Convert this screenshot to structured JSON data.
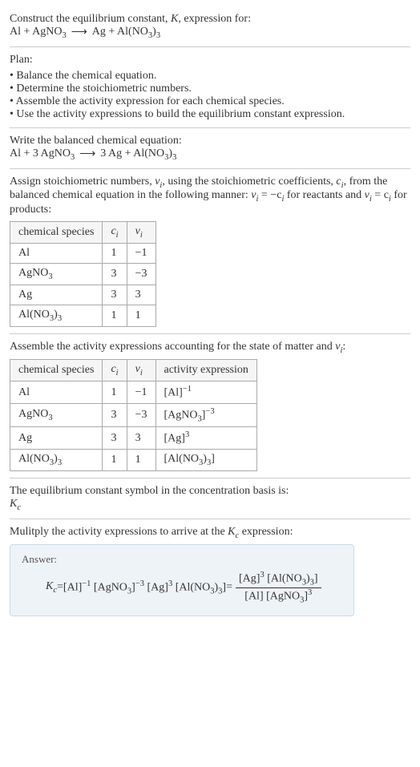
{
  "intro": {
    "line1_a": "Construct the equilibrium constant, ",
    "line1_K": "K",
    "line1_b": ", expression for:",
    "reaction_lhs": "Al + AgNO",
    "reaction_arrow": "⟶",
    "reaction_rhs_a": "Ag + Al(NO",
    "reaction_rhs_b": ")"
  },
  "plan": {
    "heading": "Plan:",
    "items": [
      "Balance the chemical equation.",
      "Determine the stoichiometric numbers.",
      "Assemble the activity expression for each chemical species.",
      "Use the activity expressions to build the equilibrium constant expression."
    ]
  },
  "balanced": {
    "heading": "Write the balanced chemical equation:",
    "lhs_a": "Al + 3 AgNO",
    "arrow": "⟶",
    "rhs_a": "3 Ag + Al(NO",
    "rhs_b": ")"
  },
  "stoich": {
    "text_a": "Assign stoichiometric numbers, ",
    "nu": "ν",
    "sub_i": "i",
    "text_b": ", using the stoichiometric coefficients, ",
    "c": "c",
    "text_c": ", from the balanced chemical equation in the following manner: ",
    "eq1_a": "ν",
    "eq1_b": " = −c",
    "text_d": " for reactants and ",
    "eq2_a": "ν",
    "eq2_b": " = c",
    "text_e": " for products:",
    "headers": {
      "species": "chemical species",
      "ci": "c",
      "nui": "ν"
    },
    "rows": [
      {
        "species": "Al",
        "ci": "1",
        "nui": "−1"
      },
      {
        "species": "AgNO",
        "ci": "3",
        "nui": "−3"
      },
      {
        "species": "Ag",
        "ci": "3",
        "nui": "3"
      },
      {
        "species": "Al(NO",
        "ci": "1",
        "nui": "1"
      }
    ]
  },
  "activity": {
    "heading_a": "Assemble the activity expressions accounting for the state of matter and ",
    "heading_b": ":",
    "headers": {
      "species": "chemical species",
      "ci": "c",
      "nui": "ν",
      "act": "activity expression"
    },
    "rows": [
      {
        "species": "Al",
        "ci": "1",
        "nui": "−1",
        "act_base": "[Al]",
        "act_exp": "−1"
      },
      {
        "species": "AgNO",
        "ci": "3",
        "nui": "−3",
        "act_base": "[AgNO",
        "act_exp": "−3"
      },
      {
        "species": "Ag",
        "ci": "3",
        "nui": "3",
        "act_base": "[Ag]",
        "act_exp": "3"
      },
      {
        "species": "Al(NO",
        "ci": "1",
        "nui": "1",
        "act_base": "[Al(NO",
        "act_exp": ""
      }
    ]
  },
  "symbol": {
    "line": "The equilibrium constant symbol in the concentration basis is:",
    "Kc_K": "K",
    "Kc_c": "c"
  },
  "multiply": {
    "line_a": "Mulitply the activity expressions to arrive at the ",
    "line_b": " expression:"
  },
  "answer": {
    "label": "Answer:",
    "lhs_K": "K",
    "lhs_c": "c",
    "eq": " = ",
    "t1": "[Al]",
    "e1": "−1",
    "t2": " [AgNO",
    "e2": "−3",
    "t3": " [Ag]",
    "e3": "3",
    "t4": " [Al(NO",
    "t4b": ")",
    "t4c": "]",
    "eq2": " = ",
    "num_a": "[Ag]",
    "num_e": "3",
    "num_b": " [Al(NO",
    "num_c": ")",
    "num_d": "]",
    "den_a": "[Al] [AgNO",
    "den_b": "]",
    "den_e": "3"
  },
  "sub3": "3"
}
